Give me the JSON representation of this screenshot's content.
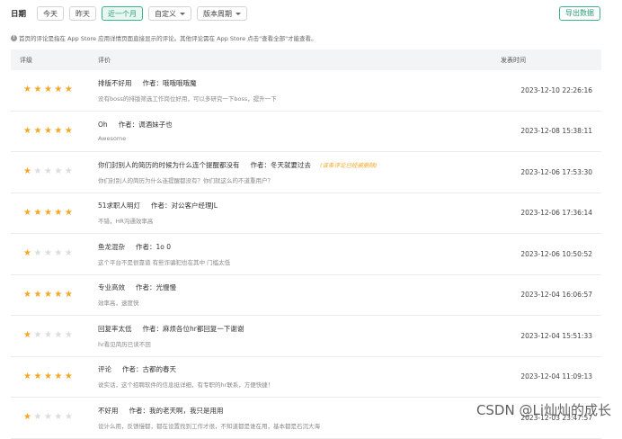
{
  "filters": {
    "label": "日期",
    "options": [
      {
        "label": "今天",
        "active": false
      },
      {
        "label": "昨天",
        "active": false
      },
      {
        "label": "近一个月",
        "active": true
      }
    ],
    "custom": "自定义",
    "version": "版本周期"
  },
  "export_label": "导出数据",
  "tip": "首页的评论是指在 App Store 应用详情页面直接显示的评论。其他评论需在 App Store 点击\"查看全部\"才能查看。",
  "table": {
    "headers": {
      "rating": "评级",
      "review": "评价",
      "time": "发表时间"
    },
    "author_prefix": "作者：",
    "rows": [
      {
        "stars": 5,
        "title": "排版不好用",
        "author": "哦哦哦哦魔",
        "deleted": "",
        "body": "没有boss的排版筛选工作岗位好用，可以多研究一下boss，提升一下",
        "time": "2023-12-10 22:26:16"
      },
      {
        "stars": 5,
        "title": "Oh",
        "author": "调酒妹子也",
        "deleted": "",
        "body": "Awesome",
        "time": "2023-12-08 15:38:11"
      },
      {
        "stars": 1,
        "title": "你们封别人的简历的时候为什么连个提醒都没有",
        "author": "冬天就要过去",
        "deleted": "(该条评论已经被删除)",
        "body": "你们封别人的简历为什么连提醒都没有？你们就这么的不道重用户？",
        "time": "2023-12-06 17:53:30"
      },
      {
        "stars": 5,
        "title": "51求职人明灯",
        "author": "对公客户经理JL",
        "deleted": "",
        "body": "不错，HR沟通效率高",
        "time": "2023-12-06 17:36:14"
      },
      {
        "stars": 1,
        "title": "鱼龙混杂",
        "author": "1o 0",
        "deleted": "",
        "body": "这个平台不是很靠谱 有些诈骗犯也在其中 门槛太低",
        "time": "2023-12-06 10:50:52"
      },
      {
        "stars": 5,
        "title": "专业高效",
        "author": "光慢慢",
        "deleted": "",
        "body": "效率高，速度快",
        "time": "2023-12-04 16:06:57"
      },
      {
        "stars": 1,
        "title": "回复率太低",
        "author": "麻烦各位hr都回复一下谢谢",
        "deleted": "",
        "body": "hr看见简历已读不回",
        "time": "2023-12-04 15:51:33"
      },
      {
        "stars": 5,
        "title": "评论",
        "author": "古都的春天",
        "deleted": "",
        "body": "说实话，这个招聘软件的信息挺详细，有专职的hr联系，方便快捷！",
        "time": "2023-12-04 11:09:13"
      },
      {
        "stars": 1,
        "title": "不好用",
        "author": "我的老天啊，我只是用用",
        "deleted": "",
        "body": "设计么用，反馈慢都，都在设置找到工作才很，不知道都是谁在用，基本都是石沉大海",
        "time": "2023-12-03 23:47:57"
      }
    ]
  },
  "watermark": "CSDN @Li灿灿的成长",
  "colors": {
    "accent": "#2a9c76",
    "star_on": "#f5a623",
    "star_off": "#dcdcdc"
  }
}
